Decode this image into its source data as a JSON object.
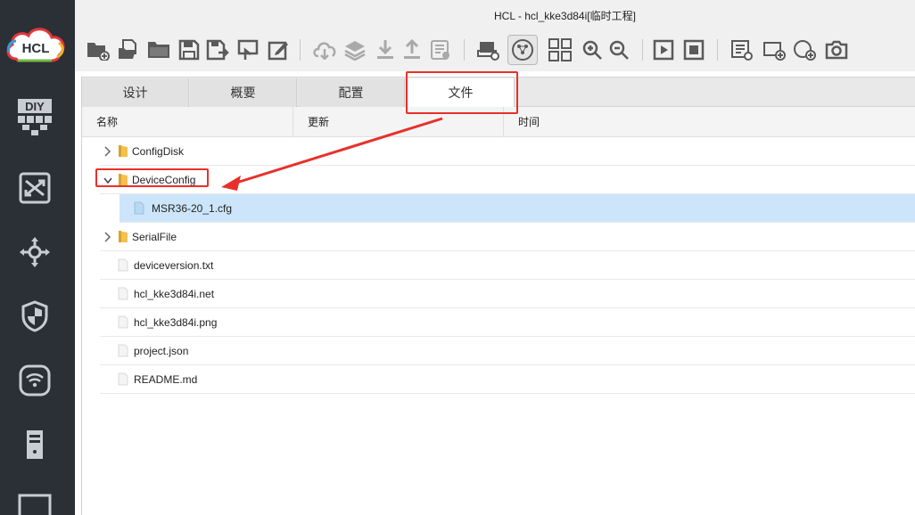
{
  "window": {
    "title": "HCL - hcl_kke3d84i[临时工程]"
  },
  "logo": {
    "text": "HCL",
    "name": "hcl-logo"
  },
  "sidebar": {
    "items": [
      {
        "name": "sidebar-item-diy",
        "icon": "diy-icon",
        "label": "DIY"
      },
      {
        "name": "sidebar-item-switch",
        "icon": "switch-icon"
      },
      {
        "name": "sidebar-item-router",
        "icon": "router-icon"
      },
      {
        "name": "sidebar-item-security",
        "icon": "shield-icon"
      },
      {
        "name": "sidebar-item-wireless",
        "icon": "wifi-icon"
      },
      {
        "name": "sidebar-item-server",
        "icon": "server-icon"
      },
      {
        "name": "sidebar-item-terminal",
        "icon": "monitor-icon"
      }
    ]
  },
  "toolbar": {
    "buttons": [
      "new-project-icon",
      "open-file-icon",
      "open-folder-icon",
      "save-icon",
      "save-as-icon",
      "export-icon",
      "edit-icon",
      "cloud-download-icon",
      "layers-icon",
      "download-icon",
      "upload-icon",
      "log-icon",
      "capture-icon",
      "topology-icon",
      "grid-icon",
      "zoom-in-icon",
      "zoom-out-icon",
      "play-icon",
      "stop-icon",
      "add-list-icon",
      "add-rect-icon",
      "add-circle-icon",
      "camera-icon"
    ]
  },
  "tabs": [
    {
      "label": "设计",
      "name": "tab-design"
    },
    {
      "label": "概要",
      "name": "tab-summary"
    },
    {
      "label": "配置",
      "name": "tab-config"
    },
    {
      "label": "文件",
      "name": "tab-files",
      "active": true
    }
  ],
  "columns": {
    "name": "名称",
    "updated": "更新",
    "time": "时间"
  },
  "files": [
    {
      "label": "ConfigDisk",
      "type": "folder",
      "expander": "collapsed",
      "indent": 0
    },
    {
      "label": "DeviceConfig",
      "type": "folder",
      "expander": "expanded",
      "indent": 0
    },
    {
      "label": "MSR36-20_1.cfg",
      "type": "file-blue",
      "indent": 1,
      "selected": true
    },
    {
      "label": "SerialFile",
      "type": "folder",
      "expander": "collapsed",
      "indent": 0
    },
    {
      "label": "deviceversion.txt",
      "type": "file",
      "indent": 0
    },
    {
      "label": "hcl_kke3d84i.net",
      "type": "file",
      "indent": 0
    },
    {
      "label": "hcl_kke3d84i.png",
      "type": "file",
      "indent": 0
    },
    {
      "label": "project.json",
      "type": "file",
      "indent": 0
    },
    {
      "label": "README.md",
      "type": "file",
      "indent": 0
    }
  ],
  "colors": {
    "annotation": "#e8302a",
    "selected_row": "#cce5fb",
    "sidebar": "#2b2f36",
    "folder": "#f2c14e"
  }
}
